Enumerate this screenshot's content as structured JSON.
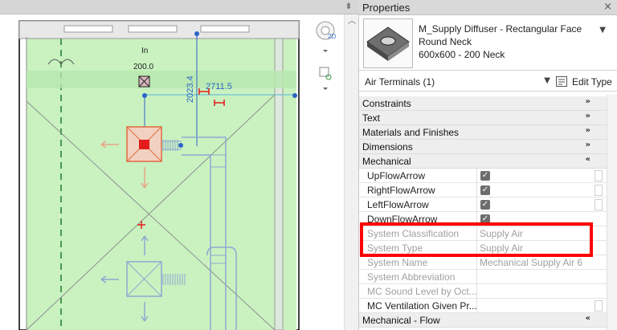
{
  "viewport": {
    "labels": {
      "in": "In",
      "elevation": "200.0",
      "dim_vertical": "2023.4",
      "dim_horizontal": "2711.5"
    },
    "navbar": {
      "wheel_badge": "2D"
    }
  },
  "properties": {
    "title": "Properties",
    "close_icon": "×",
    "type": {
      "name": "M_Supply Diffuser - Rectangular Face Round Neck",
      "size": "600x600 - 200 Neck"
    },
    "filter": "Air Terminals (1)",
    "edit_type": "Edit Type",
    "groups": {
      "constraints": "Constraints",
      "text": "Text",
      "materials": "Materials and Finishes",
      "dimensions": "Dimensions",
      "mechanical": "Mechanical",
      "mechanical_flow": "Mechanical - Flow"
    },
    "params": {
      "up_flow": "UpFlowArrow",
      "right_flow": "RightFlowArrow",
      "left_flow": "LeftFlowArrow",
      "down_flow": "DownFlowArrow",
      "system_classification": {
        "name": "System Classification",
        "value": "Supply Air"
      },
      "system_type": {
        "name": "System Type",
        "value": "Supply Air"
      },
      "system_name": {
        "name": "System Name",
        "value": "Mechanical Supply Air 6"
      },
      "system_abbreviation": {
        "name": "System Abbreviation",
        "value": ""
      },
      "mc_sound": {
        "name": "MC Sound Level by Oct...",
        "value": ""
      },
      "mc_ventilation": {
        "name": "MC Ventilation Given Pr...",
        "value": ""
      }
    }
  },
  "colors": {
    "room_fill": "#c9f2c0",
    "duct": "#8fa8d2",
    "dimension": "#2e64c8",
    "highlight": "#ff0000"
  }
}
